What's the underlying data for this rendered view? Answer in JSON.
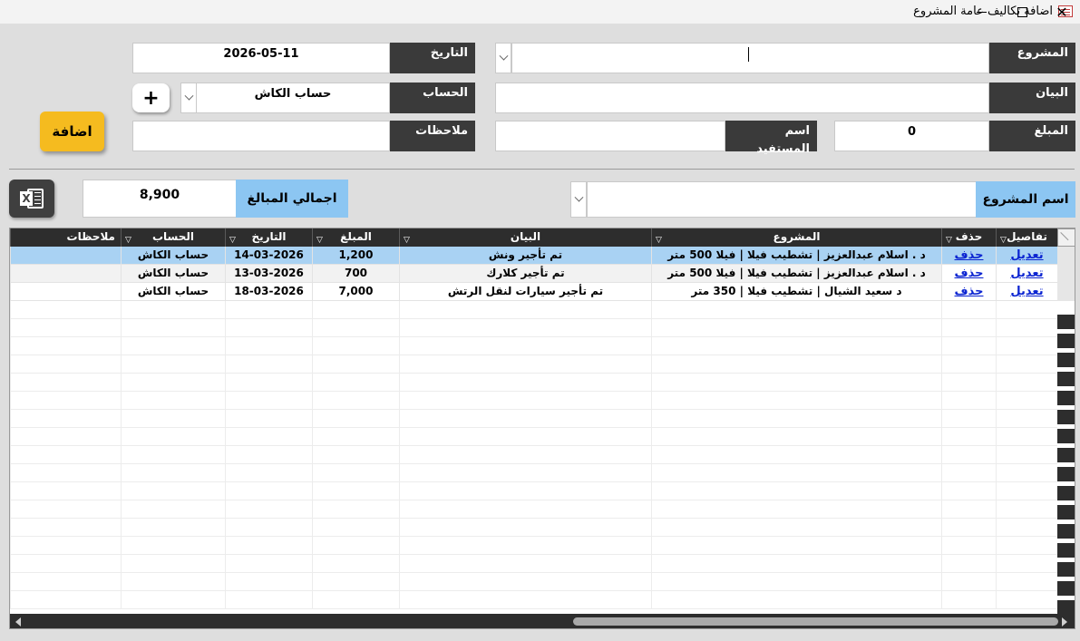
{
  "window": {
    "title": "اضافة تكاليف عامة المشروع",
    "minimize_glyph": "—",
    "close_glyph": "✕"
  },
  "form": {
    "project_label": "المشروع",
    "project_value": "",
    "date_label": "التاريخ",
    "date_value": "2026-05-11",
    "statement_label": "البيان",
    "statement_value": "",
    "account_label": "الحساب",
    "account_value": "حساب الكاش",
    "amount_label": "المبلغ",
    "amount_value": "0",
    "beneficiary_label": "اسم المستفيد",
    "beneficiary_value": "",
    "notes_label": "ملاحظات",
    "notes_value": "",
    "plus_button": "+",
    "add_button": "اضافة"
  },
  "summary": {
    "total_label": "اجمالي المبالغ",
    "total_value": "8,900",
    "project_filter_label": "اسم المشروع",
    "project_filter_value": "",
    "excel_icon": "excel-export-icon",
    "excel_letter": "X"
  },
  "table": {
    "columns": [
      "تفاصيل",
      "حذف",
      "المشروع",
      "البيان",
      "المبلغ",
      "التاريخ",
      "الحساب",
      "ملاحظات"
    ],
    "rows": [
      {
        "details": "تعديل",
        "delete": "حذف",
        "project": "د . اسلام عبدالعزيز | تشطيب فيلا | فيلا 500 متر",
        "statement": "تم تأجير ونش",
        "amount": "1,200",
        "date": "14-03-2026",
        "account": "حساب الكاش",
        "notes": ""
      },
      {
        "details": "تعديل",
        "delete": "حذف",
        "project": "د . اسلام عبدالعزيز | تشطيب فيلا | فيلا 500 متر",
        "statement": "تم تأجير كلارك",
        "amount": "700",
        "date": "13-03-2026",
        "account": "حساب الكاش",
        "notes": ""
      },
      {
        "details": "تعديل",
        "delete": "حذف",
        "project": "د سعيد الشيال | تشطيب فيلا | 350 متر",
        "statement": "تم تأجير سيارات لنقل الرتش",
        "amount": "7,000",
        "date": "18-03-2026",
        "account": "حساب الكاش",
        "notes": ""
      }
    ]
  },
  "colors": {
    "label_bg": "#3a3a3a",
    "accent_blue": "#8cc6f2",
    "add_button": "#f5bb1f",
    "selected_row": "#a9d2f3",
    "link": "#0b24d1"
  }
}
